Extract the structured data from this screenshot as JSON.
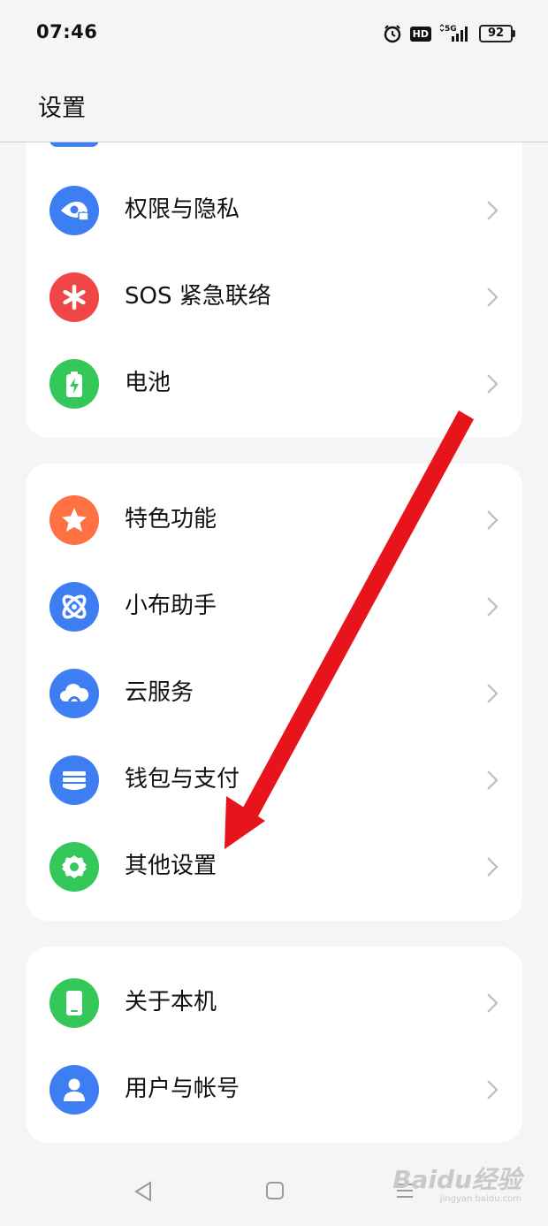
{
  "status_bar": {
    "time": "07:46",
    "network": "5G",
    "hd_badge": "HD",
    "battery": "92"
  },
  "header": {
    "title": "设置"
  },
  "groups": [
    {
      "items": [
        {
          "label": "权限与隐私",
          "icon": "eye-lock-icon",
          "color": "#3d7ef2"
        },
        {
          "label": "SOS 紧急联络",
          "icon": "sos-asterisk-icon",
          "color": "#ef4747"
        },
        {
          "label": "电池",
          "icon": "battery-icon",
          "color": "#34c759"
        }
      ]
    },
    {
      "items": [
        {
          "label": "特色功能",
          "icon": "star-icon",
          "color": "#ff7043"
        },
        {
          "label": "小布助手",
          "icon": "assistant-icon",
          "color": "#3d7ef2"
        },
        {
          "label": "云服务",
          "icon": "cloud-icon",
          "color": "#3d7ef2"
        },
        {
          "label": "钱包与支付",
          "icon": "wallet-icon",
          "color": "#3d7ef2"
        },
        {
          "label": "其他设置",
          "icon": "gear-icon",
          "color": "#34c759"
        }
      ]
    },
    {
      "items": [
        {
          "label": "关于本机",
          "icon": "phone-icon",
          "color": "#34c759"
        },
        {
          "label": "用户与帐号",
          "icon": "user-icon",
          "color": "#3d7ef2"
        }
      ]
    }
  ],
  "watermark": {
    "main": "Baidu经验",
    "sub": "jingyan.baidu.com"
  },
  "colors": {
    "background": "#f5f5f5",
    "card": "#ffffff",
    "accent_blue": "#3d7ef2",
    "accent_green": "#34c759",
    "accent_red": "#ef4747",
    "accent_orange": "#ff7043",
    "annotation_arrow": "#e8141c"
  }
}
